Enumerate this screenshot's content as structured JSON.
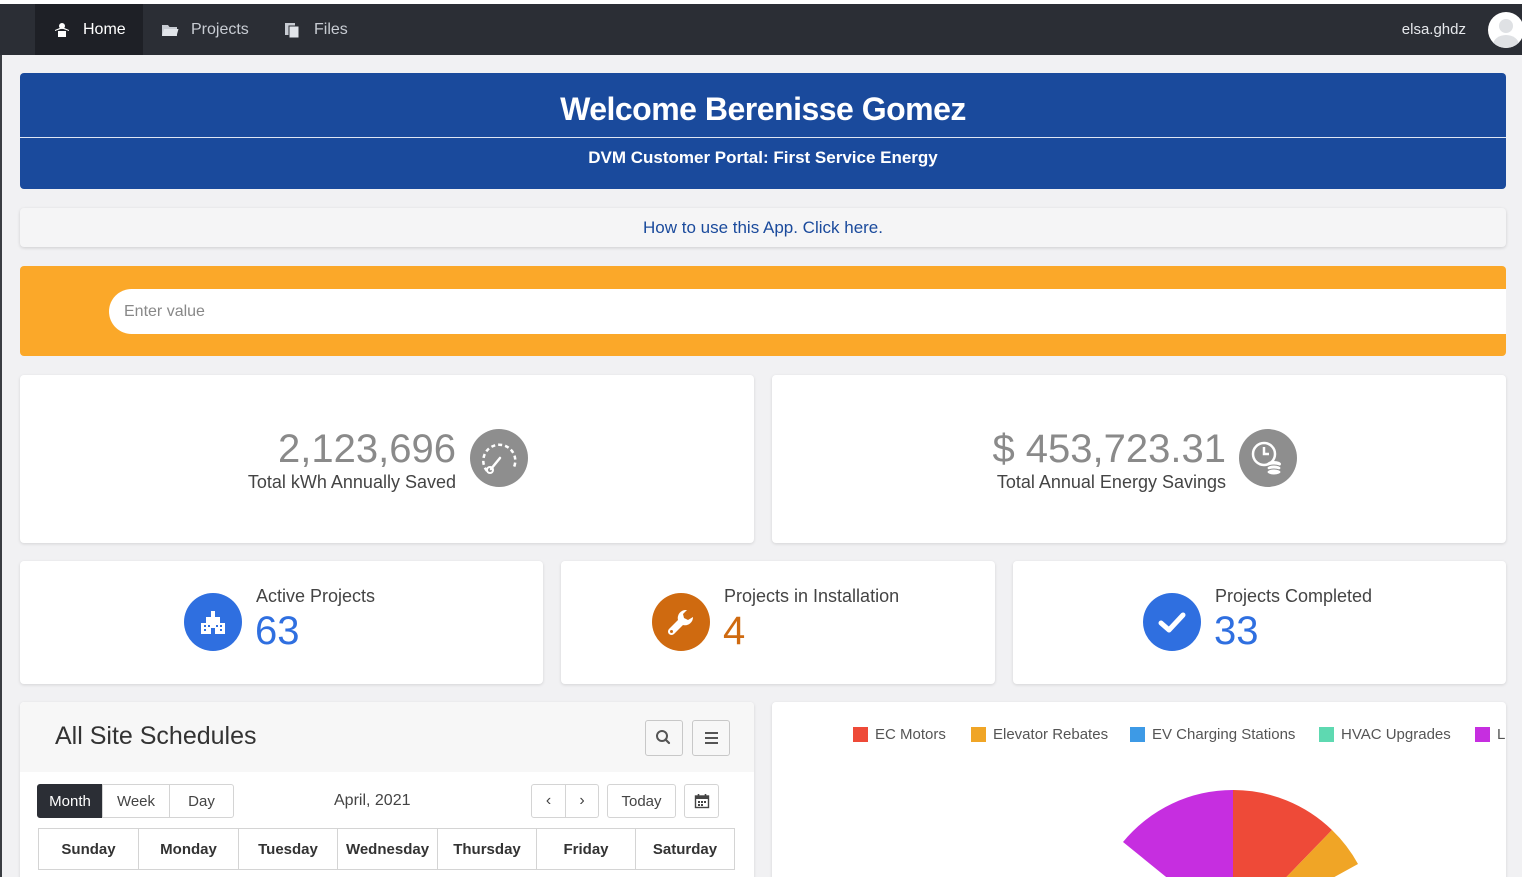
{
  "nav": {
    "home": "Home",
    "projects": "Projects",
    "files": "Files",
    "username": "elsa.ghdz"
  },
  "banner": {
    "title": "Welcome Berenisse Gomez",
    "subtitle": "DVM Customer Portal: First Service Energy"
  },
  "help": {
    "link": "How to use this App. Click here."
  },
  "search": {
    "placeholder": "Enter value"
  },
  "stats": {
    "kwh": {
      "value": "2,123,696",
      "label": "Total kWh Annually Saved",
      "icon": "gauge-icon"
    },
    "savings": {
      "value": "$ 453,723.31",
      "label": "Total Annual Energy Savings",
      "icon": "clock-coins-icon"
    }
  },
  "counters": {
    "active": {
      "label": "Active Projects",
      "value": "63",
      "color": "#2f6fe0",
      "icon": "building-icon"
    },
    "installation": {
      "label": "Projects in Installation",
      "value": "4",
      "color": "#cf6a10",
      "icon": "wrench-icon"
    },
    "completed": {
      "label": "Projects Completed",
      "value": "33",
      "color": "#2f6fe0",
      "icon": "check-icon"
    }
  },
  "schedule": {
    "title": "All Site Schedules",
    "views": [
      "Month",
      "Week",
      "Day"
    ],
    "active_view": "Month",
    "month": "April, 2021",
    "today": "Today",
    "days": [
      "Sunday",
      "Monday",
      "Tuesday",
      "Wednesday",
      "Thursday",
      "Friday",
      "Saturday"
    ]
  },
  "chart_legend": [
    {
      "label": "EC Motors",
      "color": "#ee4a38"
    },
    {
      "label": "Elevator Rebates",
      "color": "#f0a526"
    },
    {
      "label": "EV Charging Stations",
      "color": "#3d9ae6"
    },
    {
      "label": "HVAC Upgrades",
      "color": "#5ed9b1"
    },
    {
      "label": "L",
      "color": "#c62ee0"
    }
  ]
}
